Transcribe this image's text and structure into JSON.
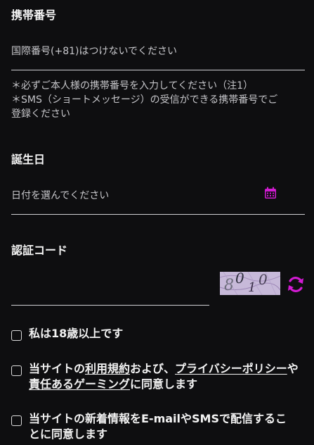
{
  "phone": {
    "label": "携帯番号",
    "placeholder": "国際番号(+81)はつけないでください",
    "notes": [
      "＊必ずご本人様の携帯番号を入力してください（注1）",
      "＊SMS（ショートメッセージ）の受信ができる携帯番号でご",
      "登録ください"
    ]
  },
  "birthday": {
    "label": "誕生日",
    "placeholder": "日付を選んでください",
    "icon": "calendar-icon"
  },
  "auth_code": {
    "label": "認証コード",
    "captcha_text": "8010",
    "refresh_icon": "refresh-icon"
  },
  "checkboxes": {
    "age": {
      "text": "私は18歳以上です",
      "checked": false
    },
    "terms": {
      "prefix": "当サイトの",
      "link_terms": "利用規約",
      "mid1": "および、",
      "link_privacy": "プライバシーポリシー",
      "mid2": "や",
      "link_gaming": "責任あるゲーミング",
      "suffix": "に同意します",
      "checked": false
    },
    "newsletter": {
      "text": "当サイトの新着情報をE-mailやSMSで配信することに同意します",
      "checked": false
    }
  },
  "colors": {
    "accent": "#d21bd2",
    "background": "#0e0e10",
    "text": "#f2f2f2"
  }
}
